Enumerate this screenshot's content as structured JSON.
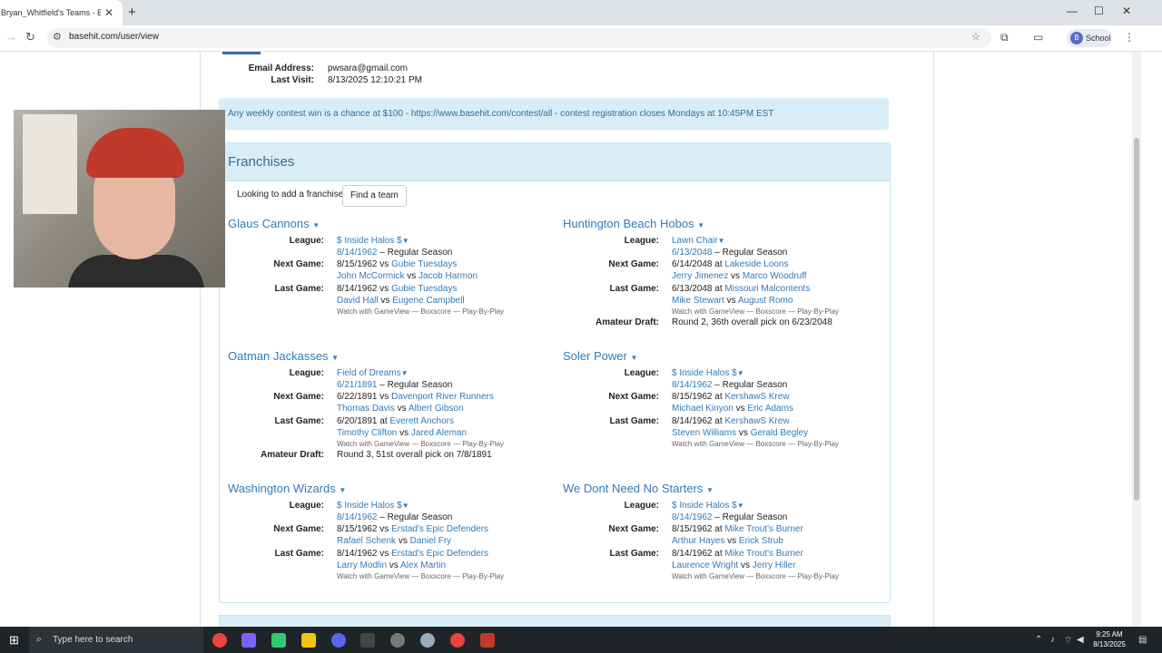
{
  "browser": {
    "tab_title": "Bryan_Whitfield's Teams - Baseh",
    "url": "basehit.com/user/view",
    "profile_label": "School",
    "profile_initial": "B"
  },
  "user_info": {
    "email_label": "Email Address:",
    "email_value": "pwsara@gmail.com",
    "visit_label": "Last Visit:",
    "visit_value": "8/13/2025 12:10:21 PM"
  },
  "alert_text": "Any weekly contest win is a chance at $100 - https://www.basehit.com/contest/all - contest registration closes Mondays at 10:45PM EST",
  "franchises": {
    "heading": "Franchises",
    "add_prompt": "Looking to add a franchise?",
    "find_button": "Find a team",
    "labels": {
      "league": "League:",
      "next": "Next Game:",
      "last": "Last Game:",
      "draft": "Amateur Draft:"
    },
    "teams": [
      {
        "name": "Glaus Cannons",
        "league": "$ Inside Halos $",
        "date": "8/14/1962",
        "season": " – Regular Season",
        "next_date": "8/15/1962",
        "next_sep": " vs ",
        "next_opp": "Gubie Tuesdays",
        "next_p1": "John McCormick",
        "next_p2": "Jacob Harmon",
        "last_date": "8/14/1962",
        "last_sep": " vs ",
        "last_opp": "Gubie Tuesdays",
        "last_p1": "David Hall",
        "last_p2": "Eugene Campbell",
        "watch": "Watch with GameView — Boxscore — Play-By-Play",
        "draft": ""
      },
      {
        "name": "Huntington Beach Hobos",
        "league": "Lawn Chair",
        "date": "6/13/2048",
        "season": " – Regular Season",
        "next_date": "6/14/2048",
        "next_sep": " at ",
        "next_opp": "Lakeside Loons",
        "next_p1": "Jerry Jimenez",
        "next_p2": "Marco Woodruff",
        "last_date": "6/13/2048",
        "last_sep": " at ",
        "last_opp": "Missouri Malcontents",
        "last_p1": "Mike Stewart",
        "last_p2": "August Romo",
        "watch": "Watch with GameView — Boxscore — Play-By-Play",
        "draft": "Round 2, 36th overall pick on 6/23/2048"
      },
      {
        "name": "Oatman Jackasses",
        "league": "Field of Dreams",
        "date": "6/21/1891",
        "season": " – Regular Season",
        "next_date": "6/22/1891",
        "next_sep": " vs ",
        "next_opp": "Davenport River Runners",
        "next_p1": "Thomas Davis",
        "next_p2": "Albert Gibson",
        "last_date": "6/20/1891",
        "last_sep": " at ",
        "last_opp": "Everett Anchors",
        "last_p1": "Timothy Clifton",
        "last_p2": "Jared Aleman",
        "watch": "Watch with GameView — Boxscore — Play-By-Play",
        "draft": "Round 3, 51st overall pick on 7/8/1891"
      },
      {
        "name": "Soler Power",
        "league": "$ Inside Halos $",
        "date": "8/14/1962",
        "season": " – Regular Season",
        "next_date": "8/15/1962",
        "next_sep": " at ",
        "next_opp": "KershawS Krew",
        "next_p1": "Michael Kinyon",
        "next_p2": "Eric Adams",
        "last_date": "8/14/1962",
        "last_sep": " at ",
        "last_opp": "KershawS Krew",
        "last_p1": "Steven Williams",
        "last_p2": "Gerald Begley",
        "watch": "Watch with GameView — Boxscore — Play-By-Play",
        "draft": ""
      },
      {
        "name": "Washington Wizards",
        "league": "$ Inside Halos $",
        "date": "8/14/1962",
        "season": " – Regular Season",
        "next_date": "8/15/1962",
        "next_sep": " vs ",
        "next_opp": "Erstad's Epic Defenders",
        "next_p1": "Rafael Schenk",
        "next_p2": "Daniel Fry",
        "last_date": "8/14/1962",
        "last_sep": " vs ",
        "last_opp": "Erstad's Epic Defenders",
        "last_p1": "Larry Modlin",
        "last_p2": "Alex Martin",
        "watch": "Watch with GameView — Boxscore — Play-By-Play",
        "draft": ""
      },
      {
        "name": "We Dont Need No Starters",
        "league": "$ Inside Halos $",
        "date": "8/14/1962",
        "season": " – Regular Season",
        "next_date": "8/15/1962",
        "next_sep": " at ",
        "next_opp": "Mike Trout's Burner",
        "next_p1": "Arthur Hayes",
        "next_p2": "Erick Strub",
        "last_date": "8/14/1962",
        "last_sep": " at ",
        "last_opp": "Mike Trout's Burner",
        "last_p1": "Laurence Wright",
        "last_p2": "Jerry Hiller",
        "watch": "Watch with GameView — Boxscore — Play-By-Play",
        "draft": ""
      }
    ]
  },
  "taskbar": {
    "search_placeholder": "Type here to search",
    "time": "9:25 AM",
    "date": "8/13/2025"
  },
  "colors": {
    "link": "#337ab7",
    "alert_bg": "#d9edf7",
    "alert_text": "#31708f"
  }
}
